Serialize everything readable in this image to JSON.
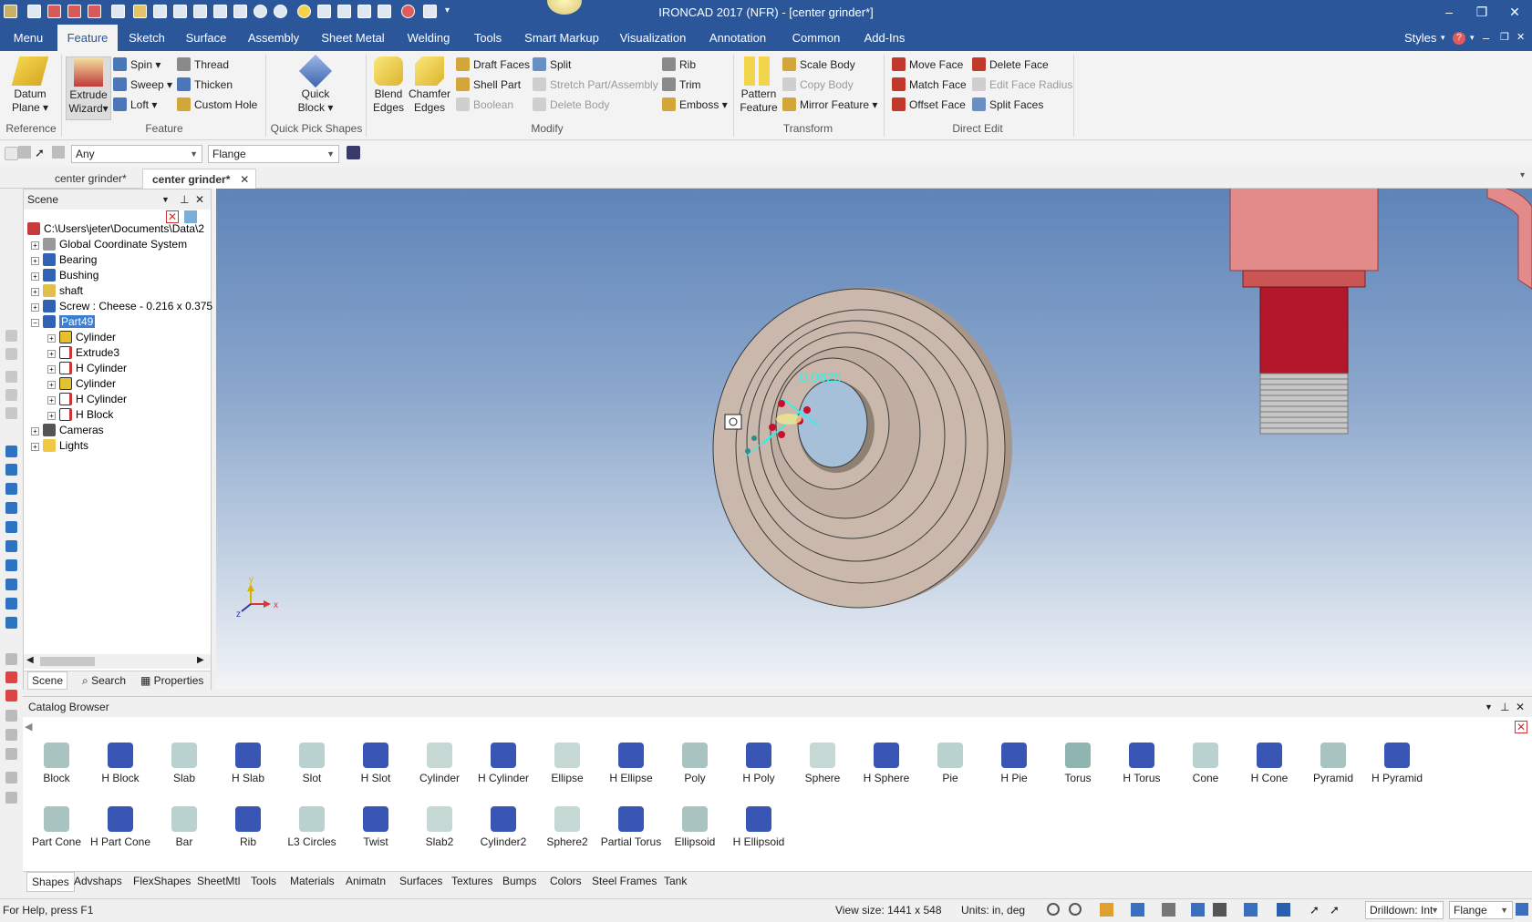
{
  "app": {
    "title": "IRONCAD 2017 (NFR) - [center grinder*]"
  },
  "menu": {
    "tabs": [
      "Menu",
      "Feature",
      "Sketch",
      "Surface",
      "Assembly",
      "Sheet Metal",
      "Welding",
      "Tools",
      "Smart Markup",
      "Visualization",
      "Annotation",
      "Common",
      "Add-Ins"
    ],
    "styles": "Styles"
  },
  "ribbon": {
    "reference": {
      "datum": "Datum",
      "plane": "Plane",
      "label": "Reference"
    },
    "feature": {
      "extrude": "Extrude",
      "wizard": "Wizard",
      "spin": "Spin",
      "sweep": "Sweep",
      "loft": "Loft",
      "thread": "Thread",
      "thicken": "Thicken",
      "custom_hole": "Custom Hole",
      "label": "Feature"
    },
    "quick": {
      "quick": "Quick",
      "block": "Block",
      "label": "Quick Pick Shapes"
    },
    "modify": {
      "blend": "Blend",
      "blend2": "Edges",
      "chamfer": "Chamfer",
      "chamfer2": "Edges",
      "draft": "Draft Faces",
      "shell": "Shell Part",
      "boolean": "Boolean",
      "split": "Split",
      "stretch": "Stretch Part/Assembly",
      "delete_body": "Delete Body",
      "rib": "Rib",
      "trim": "Trim",
      "emboss": "Emboss",
      "label": "Modify"
    },
    "transform": {
      "pattern": "Pattern",
      "pattern2": "Feature",
      "scale": "Scale Body",
      "copy": "Copy Body",
      "mirror": "Mirror Feature",
      "label": "Transform"
    },
    "direct": {
      "move": "Move Face",
      "match": "Match Face",
      "offset": "Offset Face",
      "delete": "Delete Face",
      "edit_radius": "Edit Face Radius",
      "split": "Split Faces",
      "label": "Direct Edit"
    }
  },
  "toolbar": {
    "filter": "Any",
    "type": "Flange"
  },
  "doc_tabs": [
    "center grinder*",
    "center grinder*"
  ],
  "scene": {
    "title": "Scene",
    "tree": [
      {
        "label": "C:\\Users\\jeter\\Documents\\Data\\2",
        "level": 0
      },
      {
        "label": "Global Coordinate System",
        "level": 1
      },
      {
        "label": "Bearing",
        "level": 1
      },
      {
        "label": "Bushing",
        "level": 1
      },
      {
        "label": "shaft",
        "level": 1
      },
      {
        "label": "Screw : Cheese - 0.216 x 0.375",
        "level": 1
      },
      {
        "label": "Part49",
        "level": 1
      },
      {
        "label": "Cylinder",
        "level": 2
      },
      {
        "label": "Extrude3",
        "level": 2
      },
      {
        "label": "H Cylinder",
        "level": 2
      },
      {
        "label": "Cylinder",
        "level": 2
      },
      {
        "label": "H Cylinder",
        "level": 2
      },
      {
        "label": "H Block",
        "level": 2
      },
      {
        "label": "Cameras",
        "level": 1
      },
      {
        "label": "Lights",
        "level": 1
      }
    ],
    "tabs": [
      "Scene",
      "Search",
      "Properties"
    ]
  },
  "viewport": {
    "dim_label": "0.0625",
    "axis_x": "x",
    "axis_y": "y",
    "axis_z": "z"
  },
  "catalog": {
    "title": "Catalog Browser",
    "shapes_row1": [
      "Block",
      "H Block",
      "Slab",
      "H Slab",
      "Slot",
      "H Slot",
      "Cylinder",
      "H Cylinder",
      "Ellipse",
      "H Ellipse",
      "Poly",
      "H Poly",
      "Sphere",
      "H Sphere",
      "Pie",
      "H Pie",
      "Torus",
      "H Torus",
      "Cone",
      "H Cone",
      "Pyramid",
      "H Pyramid"
    ],
    "shapes_row2": [
      "Part Cone",
      "H Part Cone",
      "Bar",
      "Rib",
      "L3 Circles",
      "Twist",
      "Slab2",
      "Cylinder2",
      "Sphere2",
      "Partial Torus",
      "Ellipsoid",
      "H Ellipsoid"
    ],
    "tabs": [
      "Shapes",
      "Advshaps",
      "FlexShapes",
      "SheetMtl",
      "Tools",
      "Materials",
      "Animatn",
      "Surfaces",
      "Textures",
      "Bumps",
      "Colors",
      "Steel Frames",
      "Tank"
    ]
  },
  "status": {
    "help": "For Help, press F1",
    "view_size": "View size: 1441 x  548",
    "units": "Units: in, deg",
    "drilldown": "Drilldown: Int",
    "flange": "Flange"
  },
  "colors": {
    "accent": "#2b579a",
    "part": "#c9b8ab",
    "red": "#b3172b",
    "pink": "#e38b8b"
  }
}
